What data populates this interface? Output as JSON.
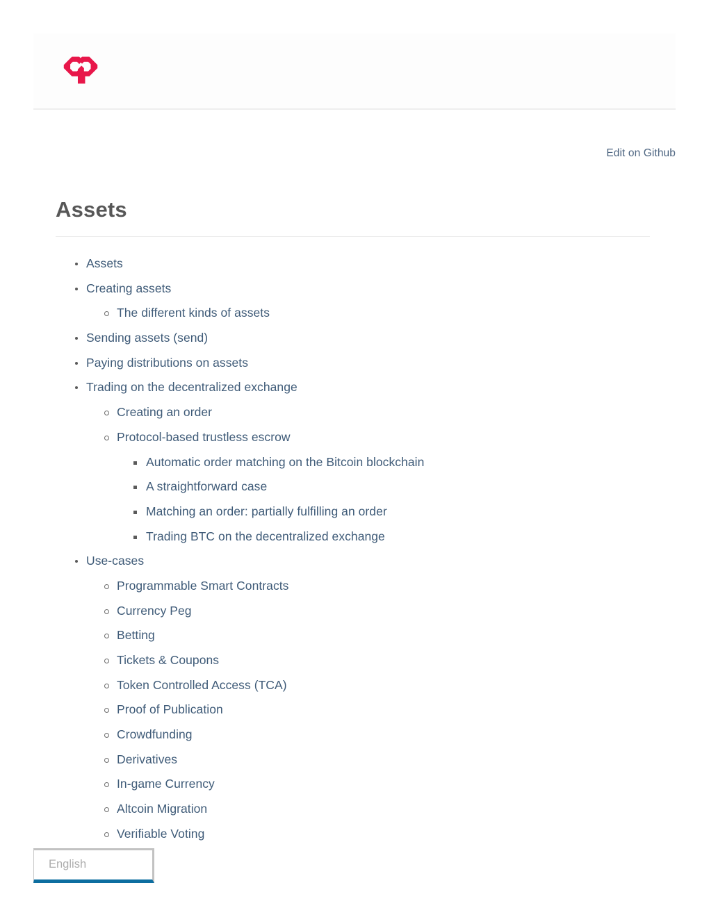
{
  "header": {
    "logo_icon": "counterparty-cp-logo",
    "logo_color": "#e8174a"
  },
  "edit": {
    "label": "Edit on Github"
  },
  "page": {
    "title": "Assets"
  },
  "toc": [
    {
      "level": 1,
      "label": "Assets"
    },
    {
      "level": 1,
      "label": "Creating assets"
    },
    {
      "level": 2,
      "label": "The different kinds of assets"
    },
    {
      "level": 1,
      "label": "Sending assets (send)"
    },
    {
      "level": 1,
      "label": "Paying distributions on assets"
    },
    {
      "level": 1,
      "label": "Trading on the decentralized exchange"
    },
    {
      "level": 2,
      "label": "Creating an order"
    },
    {
      "level": 2,
      "label": "Protocol-based trustless escrow"
    },
    {
      "level": 3,
      "label": "Automatic order matching on the Bitcoin blockchain"
    },
    {
      "level": 3,
      "label": "A straightforward case"
    },
    {
      "level": 3,
      "label": "Matching an order: partially fulfilling an order"
    },
    {
      "level": 3,
      "label": "Trading BTC on the decentralized exchange"
    },
    {
      "level": 1,
      "label": "Use-cases"
    },
    {
      "level": 2,
      "label": "Programmable Smart Contracts"
    },
    {
      "level": 2,
      "label": "Currency Peg"
    },
    {
      "level": 2,
      "label": "Betting"
    },
    {
      "level": 2,
      "label": "Tickets & Coupons"
    },
    {
      "level": 2,
      "label": "Token Controlled Access (TCA)"
    },
    {
      "level": 2,
      "label": "Proof of Publication"
    },
    {
      "level": 2,
      "label": "Crowdfunding"
    },
    {
      "level": 2,
      "label": "Derivatives"
    },
    {
      "level": 2,
      "label": "In-game Currency"
    },
    {
      "level": 2,
      "label": "Altcoin Migration"
    },
    {
      "level": 2,
      "label": "Verifiable Voting"
    }
  ],
  "language_selector": {
    "value": "English",
    "accent_color": "#0d6ea0"
  },
  "colors": {
    "link": "#3f5b78",
    "heading": "#575757",
    "brand": "#e8174a"
  }
}
